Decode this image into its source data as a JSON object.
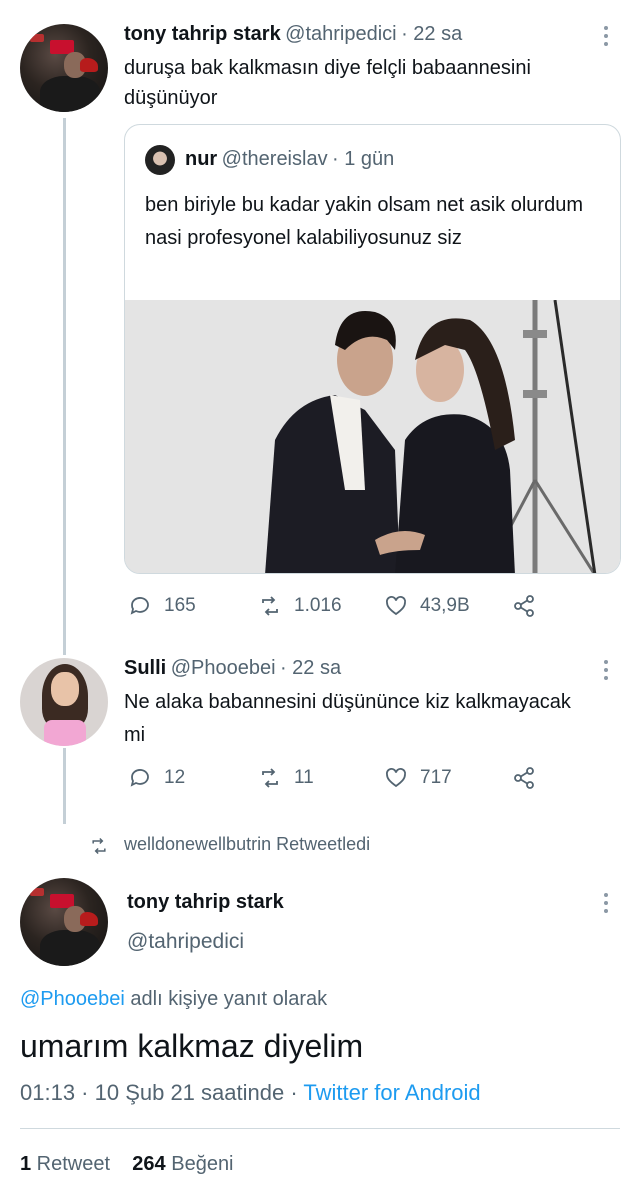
{
  "tweet1": {
    "name": "tony tahrip stark",
    "handle": "@tahripedici",
    "time": "· 22 sa",
    "text": "duruşa bak kalkmasın diye felçli babaannesini düşünüyor"
  },
  "quote": {
    "name": "nur",
    "handle": "@thereislav",
    "time": "· 1 gün",
    "text": "ben biriyle bu kadar yakin olsam net asik olurdum nasi profesyonel kalabiliyosunuz siz"
  },
  "tweet1_actions": {
    "replies": "165",
    "retweets": "1.016",
    "likes": "43,9B"
  },
  "tweet2": {
    "name": "Sulli",
    "handle": "@Phooebei",
    "time": "· 22 sa",
    "text": "Ne alaka babannesini düşününce kiz kalkmayacak mi"
  },
  "tweet2_actions": {
    "replies": "12",
    "retweets": "11",
    "likes": "717"
  },
  "retweet_label": "welldonewellbutrin Retweetledi",
  "main": {
    "name": "tony tahrip stark",
    "handle": "@tahripedici",
    "reply_to_handle": "@Phooebei",
    "reply_to_suffix": " adlı kişiye yanıt olarak",
    "text": "umarım kalkmaz diyelim",
    "time": "01:13 · 10 Şub 21 saatinde · ",
    "source": "Twitter for Android",
    "retweet_count": "1",
    "retweet_label": " Retweet",
    "like_count": "264",
    "like_label": " Beğeni"
  },
  "colors": {
    "accent": "#1d9bf0",
    "muted": "#536471",
    "line": "#c4cfd6"
  }
}
